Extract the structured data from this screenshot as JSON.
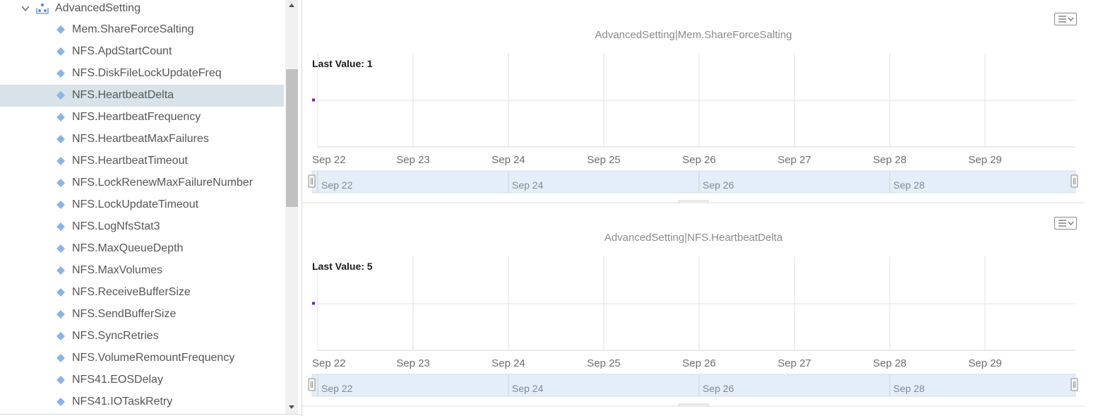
{
  "tree": {
    "parent_label": "AdvancedSetting",
    "items": [
      {
        "label": "Mem.ShareForceSalting",
        "selected": false
      },
      {
        "label": "NFS.ApdStartCount",
        "selected": false
      },
      {
        "label": "NFS.DiskFileLockUpdateFreq",
        "selected": false
      },
      {
        "label": "NFS.HeartbeatDelta",
        "selected": true
      },
      {
        "label": "NFS.HeartbeatFrequency",
        "selected": false
      },
      {
        "label": "NFS.HeartbeatMaxFailures",
        "selected": false
      },
      {
        "label": "NFS.HeartbeatTimeout",
        "selected": false
      },
      {
        "label": "NFS.LockRenewMaxFailureNumber",
        "selected": false
      },
      {
        "label": "NFS.LockUpdateTimeout",
        "selected": false
      },
      {
        "label": "NFS.LogNfsStat3",
        "selected": false
      },
      {
        "label": "NFS.MaxQueueDepth",
        "selected": false
      },
      {
        "label": "NFS.MaxVolumes",
        "selected": false
      },
      {
        "label": "NFS.ReceiveBufferSize",
        "selected": false
      },
      {
        "label": "NFS.SendBufferSize",
        "selected": false
      },
      {
        "label": "NFS.SyncRetries",
        "selected": false
      },
      {
        "label": "NFS.VolumeRemountFrequency",
        "selected": false
      },
      {
        "label": "NFS41.EOSDelay",
        "selected": false
      },
      {
        "label": "NFS41.IOTaskRetry",
        "selected": false
      }
    ],
    "icons": {
      "expand": "chevron-down-icon",
      "parent": "cluster-icon",
      "item": "diamond-icon"
    },
    "item_color": "#89b4e9",
    "selected_color": "#d8e3e9"
  },
  "charts": [
    {
      "title": "AdvancedSetting|Mem.ShareForceSalting",
      "last_value_label": "Last Value: 1",
      "menu_icon": "chart-menu-icon",
      "chart_data": {
        "type": "line",
        "x_ticks": [
          "Sep 22",
          "Sep 23",
          "Sep 24",
          "Sep 25",
          "Sep 26",
          "Sep 27",
          "Sep 28",
          "Sep 29"
        ],
        "navigator_ticks": [
          "Sep 22",
          "Sep 24",
          "Sep 26",
          "Sep 28"
        ],
        "series": [
          {
            "color": "#7b1fa2",
            "points": [
              {
                "x": "Sep 22",
                "y": 1
              }
            ]
          }
        ],
        "grid": true
      }
    },
    {
      "title": "AdvancedSetting|NFS.HeartbeatDelta",
      "last_value_label": "Last Value: 5",
      "menu_icon": "chart-menu-icon",
      "chart_data": {
        "type": "line",
        "x_ticks": [
          "Sep 22",
          "Sep 23",
          "Sep 24",
          "Sep 25",
          "Sep 26",
          "Sep 27",
          "Sep 28",
          "Sep 29"
        ],
        "navigator_ticks": [
          "Sep 22",
          "Sep 24",
          "Sep 26",
          "Sep 28"
        ],
        "series": [
          {
            "color": "#7b1fa2",
            "points": [
              {
                "x": "Sep 22",
                "y": 5
              }
            ]
          }
        ],
        "grid": true
      }
    }
  ]
}
